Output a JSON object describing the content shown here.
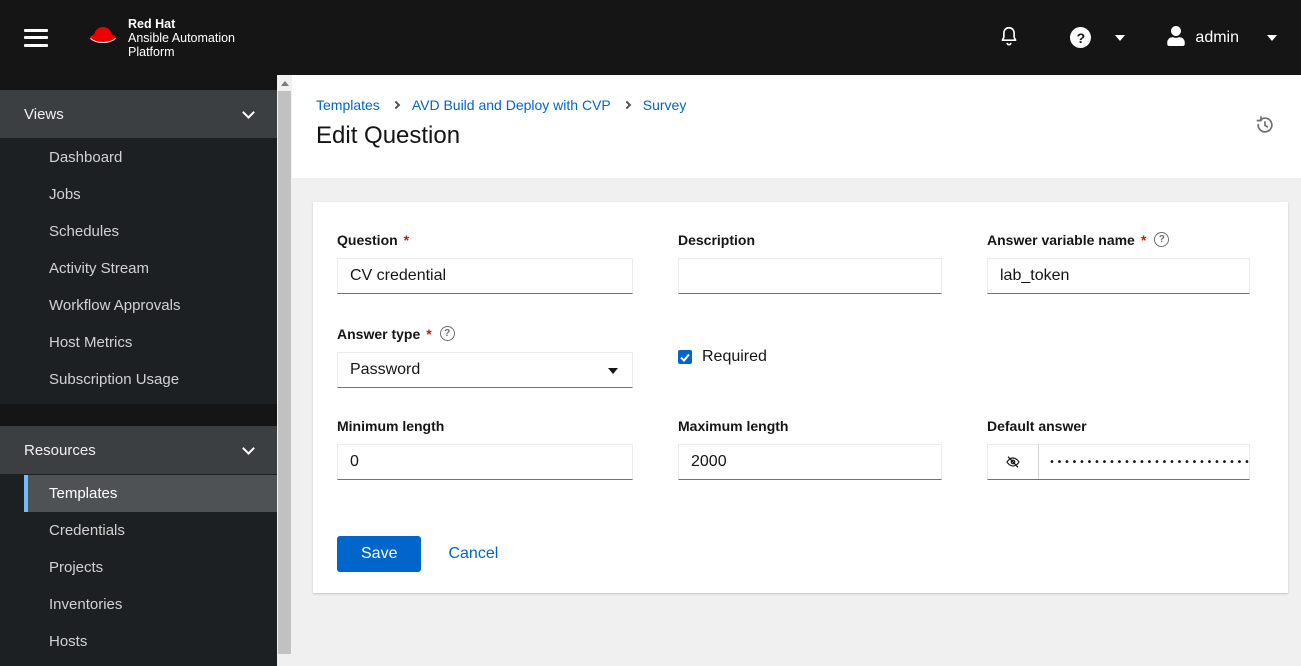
{
  "masthead": {
    "brand": {
      "line1": "Red Hat",
      "line2": "Ansible Automation",
      "line3": "Platform"
    },
    "username": "admin"
  },
  "sidebar": {
    "groups": [
      {
        "label": "Views",
        "items": [
          "Dashboard",
          "Jobs",
          "Schedules",
          "Activity Stream",
          "Workflow Approvals",
          "Host Metrics",
          "Subscription Usage"
        ]
      },
      {
        "label": "Resources",
        "items": [
          "Templates",
          "Credentials",
          "Projects",
          "Inventories",
          "Hosts"
        ],
        "selected_item": "Templates"
      }
    ]
  },
  "page": {
    "breadcrumb": [
      "Templates",
      "AVD Build and Deploy with CVP",
      "Survey"
    ],
    "title": "Edit Question"
  },
  "form": {
    "question": {
      "label": "Question",
      "required": true,
      "value": "CV credential"
    },
    "description": {
      "label": "Description",
      "value": ""
    },
    "answer_variable_name": {
      "label": "Answer variable name",
      "required": true,
      "value": "lab_token"
    },
    "answer_type": {
      "label": "Answer type",
      "required": true,
      "selected": "Password"
    },
    "required_checkbox": {
      "label": "Required",
      "checked": true
    },
    "minimum_length": {
      "label": "Minimum length",
      "value": "0"
    },
    "maximum_length": {
      "label": "Maximum length",
      "value": "2000"
    },
    "default_answer": {
      "label": "Default answer",
      "masked_value": "••••••••••••••••••••••••••••••••••••••…"
    },
    "actions": {
      "save": "Save",
      "cancel": "Cancel"
    }
  },
  "colors": {
    "accent": "#0066cc",
    "brand_red": "#ee0000",
    "nav_selected_indicator": "#73bcf7",
    "masthead_bg": "#151515",
    "required_red": "#c9190b"
  }
}
